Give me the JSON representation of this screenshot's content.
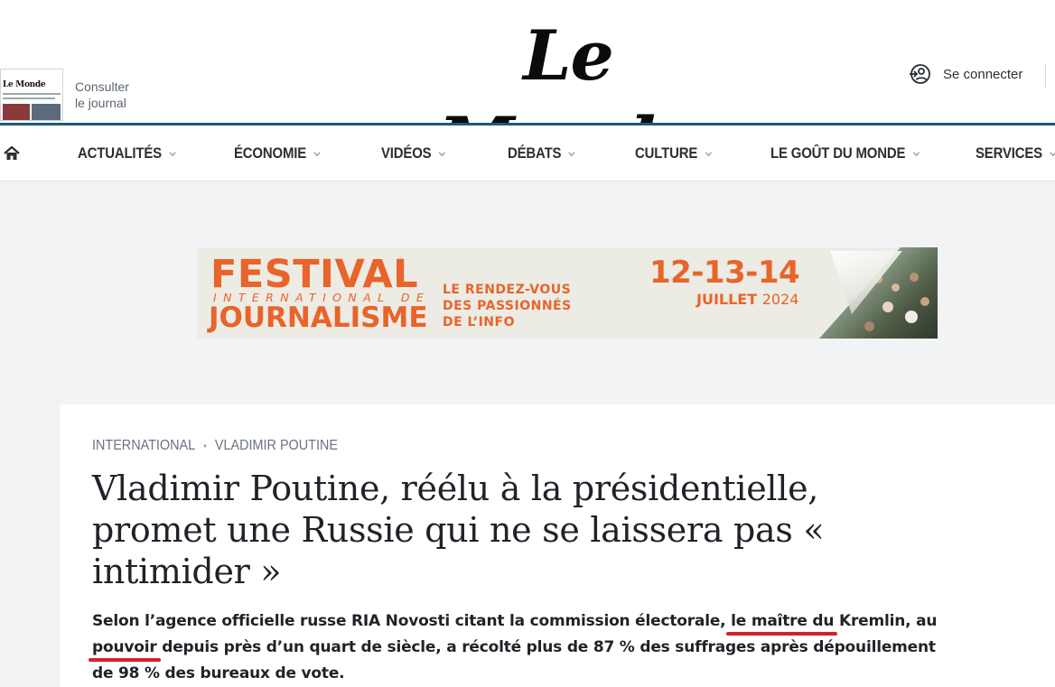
{
  "header": {
    "consult_line1": "Consulter",
    "consult_line2": "le journal",
    "logo": "Le Monde",
    "mini_logo": "Le Monde",
    "login_label": "Se connecter",
    "login_icon": "user-login-icon"
  },
  "nav": {
    "home_icon": "home-icon",
    "items": [
      {
        "label": "ACTUALITÉS"
      },
      {
        "label": "ÉCONOMIE"
      },
      {
        "label": "VIDÉOS"
      },
      {
        "label": "DÉBATS"
      },
      {
        "label": "CULTURE"
      },
      {
        "label": "LE GOÛT DU MONDE"
      },
      {
        "label": "SERVICES"
      }
    ]
  },
  "ad": {
    "line1": "FESTIVAL",
    "line2": "INTERNATIONAL DE",
    "line3": "JOURNALISME",
    "tagline": [
      "LE RENDEZ-VOUS",
      "DES PASSIONNÉS",
      "DE L’INFO"
    ],
    "dates": "12-13-14",
    "month": "JUILLET",
    "year": "2024",
    "accent_color": "#e8642a"
  },
  "article": {
    "kicker_section": "INTERNATIONAL",
    "kicker_topic": "VLADIMIR POUTINE",
    "headline": "Vladimir Poutine, réélu à la présidentielle, promet une Russie qui ne se laissera pas « intimider »",
    "lead": "Selon l’agence officielle russe RIA Novosti citant la commission électorale, le maître du Kremlin, au pouvoir depuis près d’un quart de siècle, a récolté plus de 87 % des suffrages après dépouillement de 98 % des bureaux de vote.",
    "highlight_color": "#d41f2b"
  }
}
